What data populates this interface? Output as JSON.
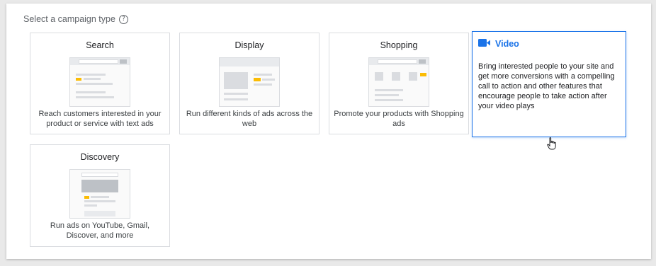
{
  "heading": "Select a campaign type",
  "help_glyph": "?",
  "cards": [
    {
      "title": "Search",
      "description": "Reach customers interested in your product or service with text ads"
    },
    {
      "title": "Display",
      "description": "Run different kinds of ads across the web"
    },
    {
      "title": "Shopping",
      "description": "Promote your products with Shopping ads"
    },
    {
      "title": "Video",
      "description": "Bring interested people to your site and get more conversions with a compelling call to action and other features that encourage people to take action after your video plays",
      "selected": true
    },
    {
      "title": "Discovery",
      "description": "Run ads on YouTube, Gmail, Discover, and more"
    }
  ],
  "icons": {
    "help": "help-circle-icon",
    "video": "video-camera-icon",
    "cursor": "hand-pointer-cursor"
  },
  "colors": {
    "accent": "#1a73e8",
    "ad_highlight": "#fbbc04",
    "border": "#dadce0"
  }
}
